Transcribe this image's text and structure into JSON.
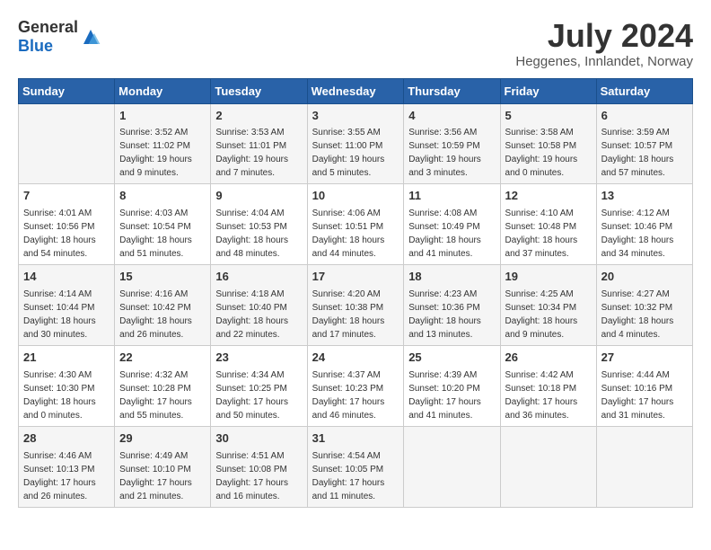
{
  "header": {
    "logo_general": "General",
    "logo_blue": "Blue",
    "month_year": "July 2024",
    "location": "Heggenes, Innlandet, Norway"
  },
  "calendar": {
    "days_of_week": [
      "Sunday",
      "Monday",
      "Tuesday",
      "Wednesday",
      "Thursday",
      "Friday",
      "Saturday"
    ],
    "weeks": [
      [
        {
          "day": "",
          "info": ""
        },
        {
          "day": "1",
          "info": "Sunrise: 3:52 AM\nSunset: 11:02 PM\nDaylight: 19 hours\nand 9 minutes."
        },
        {
          "day": "2",
          "info": "Sunrise: 3:53 AM\nSunset: 11:01 PM\nDaylight: 19 hours\nand 7 minutes."
        },
        {
          "day": "3",
          "info": "Sunrise: 3:55 AM\nSunset: 11:00 PM\nDaylight: 19 hours\nand 5 minutes."
        },
        {
          "day": "4",
          "info": "Sunrise: 3:56 AM\nSunset: 10:59 PM\nDaylight: 19 hours\nand 3 minutes."
        },
        {
          "day": "5",
          "info": "Sunrise: 3:58 AM\nSunset: 10:58 PM\nDaylight: 19 hours\nand 0 minutes."
        },
        {
          "day": "6",
          "info": "Sunrise: 3:59 AM\nSunset: 10:57 PM\nDaylight: 18 hours\nand 57 minutes."
        }
      ],
      [
        {
          "day": "7",
          "info": "Sunrise: 4:01 AM\nSunset: 10:56 PM\nDaylight: 18 hours\nand 54 minutes."
        },
        {
          "day": "8",
          "info": "Sunrise: 4:03 AM\nSunset: 10:54 PM\nDaylight: 18 hours\nand 51 minutes."
        },
        {
          "day": "9",
          "info": "Sunrise: 4:04 AM\nSunset: 10:53 PM\nDaylight: 18 hours\nand 48 minutes."
        },
        {
          "day": "10",
          "info": "Sunrise: 4:06 AM\nSunset: 10:51 PM\nDaylight: 18 hours\nand 44 minutes."
        },
        {
          "day": "11",
          "info": "Sunrise: 4:08 AM\nSunset: 10:49 PM\nDaylight: 18 hours\nand 41 minutes."
        },
        {
          "day": "12",
          "info": "Sunrise: 4:10 AM\nSunset: 10:48 PM\nDaylight: 18 hours\nand 37 minutes."
        },
        {
          "day": "13",
          "info": "Sunrise: 4:12 AM\nSunset: 10:46 PM\nDaylight: 18 hours\nand 34 minutes."
        }
      ],
      [
        {
          "day": "14",
          "info": "Sunrise: 4:14 AM\nSunset: 10:44 PM\nDaylight: 18 hours\nand 30 minutes."
        },
        {
          "day": "15",
          "info": "Sunrise: 4:16 AM\nSunset: 10:42 PM\nDaylight: 18 hours\nand 26 minutes."
        },
        {
          "day": "16",
          "info": "Sunrise: 4:18 AM\nSunset: 10:40 PM\nDaylight: 18 hours\nand 22 minutes."
        },
        {
          "day": "17",
          "info": "Sunrise: 4:20 AM\nSunset: 10:38 PM\nDaylight: 18 hours\nand 17 minutes."
        },
        {
          "day": "18",
          "info": "Sunrise: 4:23 AM\nSunset: 10:36 PM\nDaylight: 18 hours\nand 13 minutes."
        },
        {
          "day": "19",
          "info": "Sunrise: 4:25 AM\nSunset: 10:34 PM\nDaylight: 18 hours\nand 9 minutes."
        },
        {
          "day": "20",
          "info": "Sunrise: 4:27 AM\nSunset: 10:32 PM\nDaylight: 18 hours\nand 4 minutes."
        }
      ],
      [
        {
          "day": "21",
          "info": "Sunrise: 4:30 AM\nSunset: 10:30 PM\nDaylight: 18 hours\nand 0 minutes."
        },
        {
          "day": "22",
          "info": "Sunrise: 4:32 AM\nSunset: 10:28 PM\nDaylight: 17 hours\nand 55 minutes."
        },
        {
          "day": "23",
          "info": "Sunrise: 4:34 AM\nSunset: 10:25 PM\nDaylight: 17 hours\nand 50 minutes."
        },
        {
          "day": "24",
          "info": "Sunrise: 4:37 AM\nSunset: 10:23 PM\nDaylight: 17 hours\nand 46 minutes."
        },
        {
          "day": "25",
          "info": "Sunrise: 4:39 AM\nSunset: 10:20 PM\nDaylight: 17 hours\nand 41 minutes."
        },
        {
          "day": "26",
          "info": "Sunrise: 4:42 AM\nSunset: 10:18 PM\nDaylight: 17 hours\nand 36 minutes."
        },
        {
          "day": "27",
          "info": "Sunrise: 4:44 AM\nSunset: 10:16 PM\nDaylight: 17 hours\nand 31 minutes."
        }
      ],
      [
        {
          "day": "28",
          "info": "Sunrise: 4:46 AM\nSunset: 10:13 PM\nDaylight: 17 hours\nand 26 minutes."
        },
        {
          "day": "29",
          "info": "Sunrise: 4:49 AM\nSunset: 10:10 PM\nDaylight: 17 hours\nand 21 minutes."
        },
        {
          "day": "30",
          "info": "Sunrise: 4:51 AM\nSunset: 10:08 PM\nDaylight: 17 hours\nand 16 minutes."
        },
        {
          "day": "31",
          "info": "Sunrise: 4:54 AM\nSunset: 10:05 PM\nDaylight: 17 hours\nand 11 minutes."
        },
        {
          "day": "",
          "info": ""
        },
        {
          "day": "",
          "info": ""
        },
        {
          "day": "",
          "info": ""
        }
      ]
    ]
  }
}
